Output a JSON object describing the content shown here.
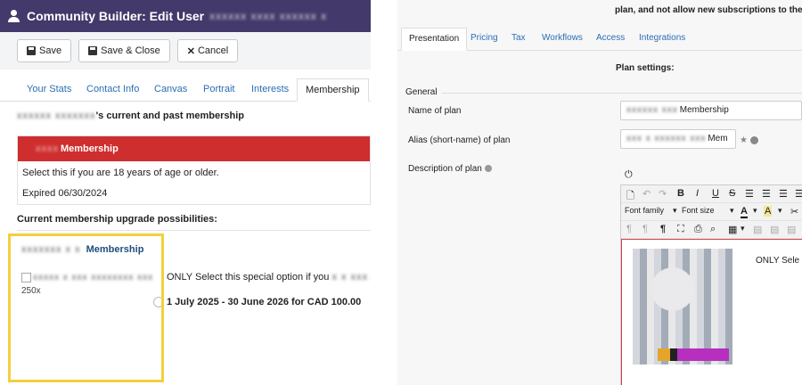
{
  "left": {
    "title": "Community Builder: Edit User",
    "title_user_redacted": "xxxxxx xxxx xxxxxx x",
    "toolbar": {
      "save": "Save",
      "save_close": "Save & Close",
      "cancel": "Cancel"
    },
    "tabs": [
      "Your Stats",
      "Contact Info",
      "Canvas",
      "Portrait",
      "Interests",
      "Membership"
    ],
    "active_tab": "Membership",
    "owner_redacted": "xxxxxx xxxxxxx",
    "owner_suffix": "'s current and past membership",
    "current_plan": {
      "name_redacted": "xxxx",
      "name": "Membership",
      "description": "Select this if you are 18 years of age or older.",
      "expiry": "Expired 06/30/2024"
    },
    "upgrade_title": "Current membership upgrade possibilities:",
    "upgrade": {
      "name_redacted": "xxxxxxx x x",
      "name": "Membership",
      "image_alt_redacted": "xxxxx x xxx xxxxxxxx xxx",
      "image_alt_suffix": "250x",
      "text": "ONLY Select this special option if you",
      "text_redacted": "x x xxx xxxx x",
      "price": "1 July 2025 - 30 June 2026 for CAD 100.00"
    }
  },
  "right": {
    "top_note": "plan, and not allow new subscriptions to the old plan",
    "tabs": [
      "Presentation",
      "Pricing",
      "Tax",
      "Workflows",
      "Access",
      "Integrations"
    ],
    "active_tab": "Presentation",
    "plan_settings": "Plan settings:",
    "general": "General",
    "fields": {
      "name_label": "Name of plan",
      "name_redacted": "xxxxxx xxx",
      "name_value": "Membership",
      "alias_label": "Alias (short-name) of plan",
      "alias_redacted": "xxx x xxxxxx xxx",
      "alias_value": "Mem",
      "description_label": "Description of plan"
    },
    "editor": {
      "font_family": "Font family",
      "font_size": "Font size",
      "content_text": "ONLY Sele"
    }
  }
}
